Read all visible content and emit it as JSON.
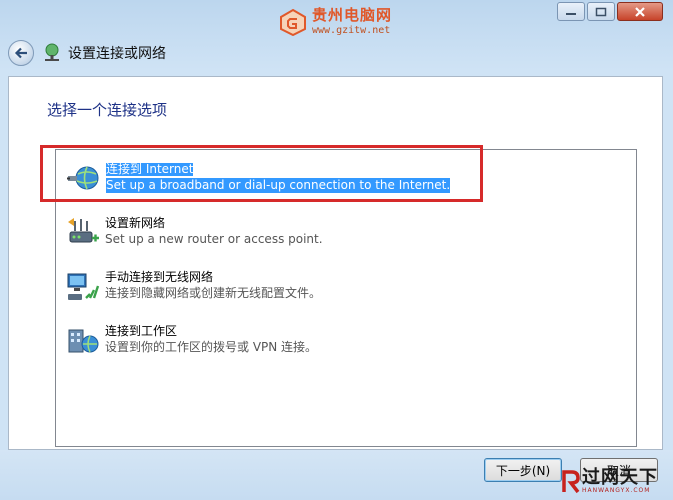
{
  "window": {
    "controls": [
      {
        "name": "minimize",
        "icon": "minimize-icon"
      },
      {
        "name": "maximize",
        "icon": "maximize-icon"
      },
      {
        "name": "close",
        "icon": "close-icon"
      }
    ]
  },
  "watermark": {
    "title": "贵州电脑网",
    "url": "www.gzitw.net",
    "icon": "gl-logo-icon"
  },
  "nav": {
    "back_icon": "back-arrow-icon",
    "title_icon": "network-icon",
    "title": "设置连接或网络"
  },
  "main": {
    "heading": "选择一个连接选项",
    "options": [
      {
        "title": "连接到 Internet",
        "desc": "Set up a broadband or dial-up connection to the Internet.",
        "icon": "globe-connection-icon",
        "selected": true
      },
      {
        "title": "设置新网络",
        "desc": "Set up a new router or access point.",
        "icon": "new-network-icon",
        "selected": false
      },
      {
        "title": "手动连接到无线网络",
        "desc": "连接到隐藏网络或创建新无线配置文件。",
        "icon": "wireless-network-icon",
        "selected": false
      },
      {
        "title": "连接到工作区",
        "desc": "设置到你的工作区的拨号或 VPN 连接。",
        "icon": "workplace-icon",
        "selected": false
      }
    ]
  },
  "footer": {
    "next_label": "下一步(N)",
    "cancel_label": "取消"
  },
  "corner_logo": {
    "main": "过网天下",
    "sub": "HANWANGYX.COM",
    "icon": "r-logo-icon"
  },
  "colors": {
    "selection": "#3399ff",
    "heading": "#1e3287",
    "highlight_border": "#d62a2a",
    "watermark": "#e0582a"
  }
}
